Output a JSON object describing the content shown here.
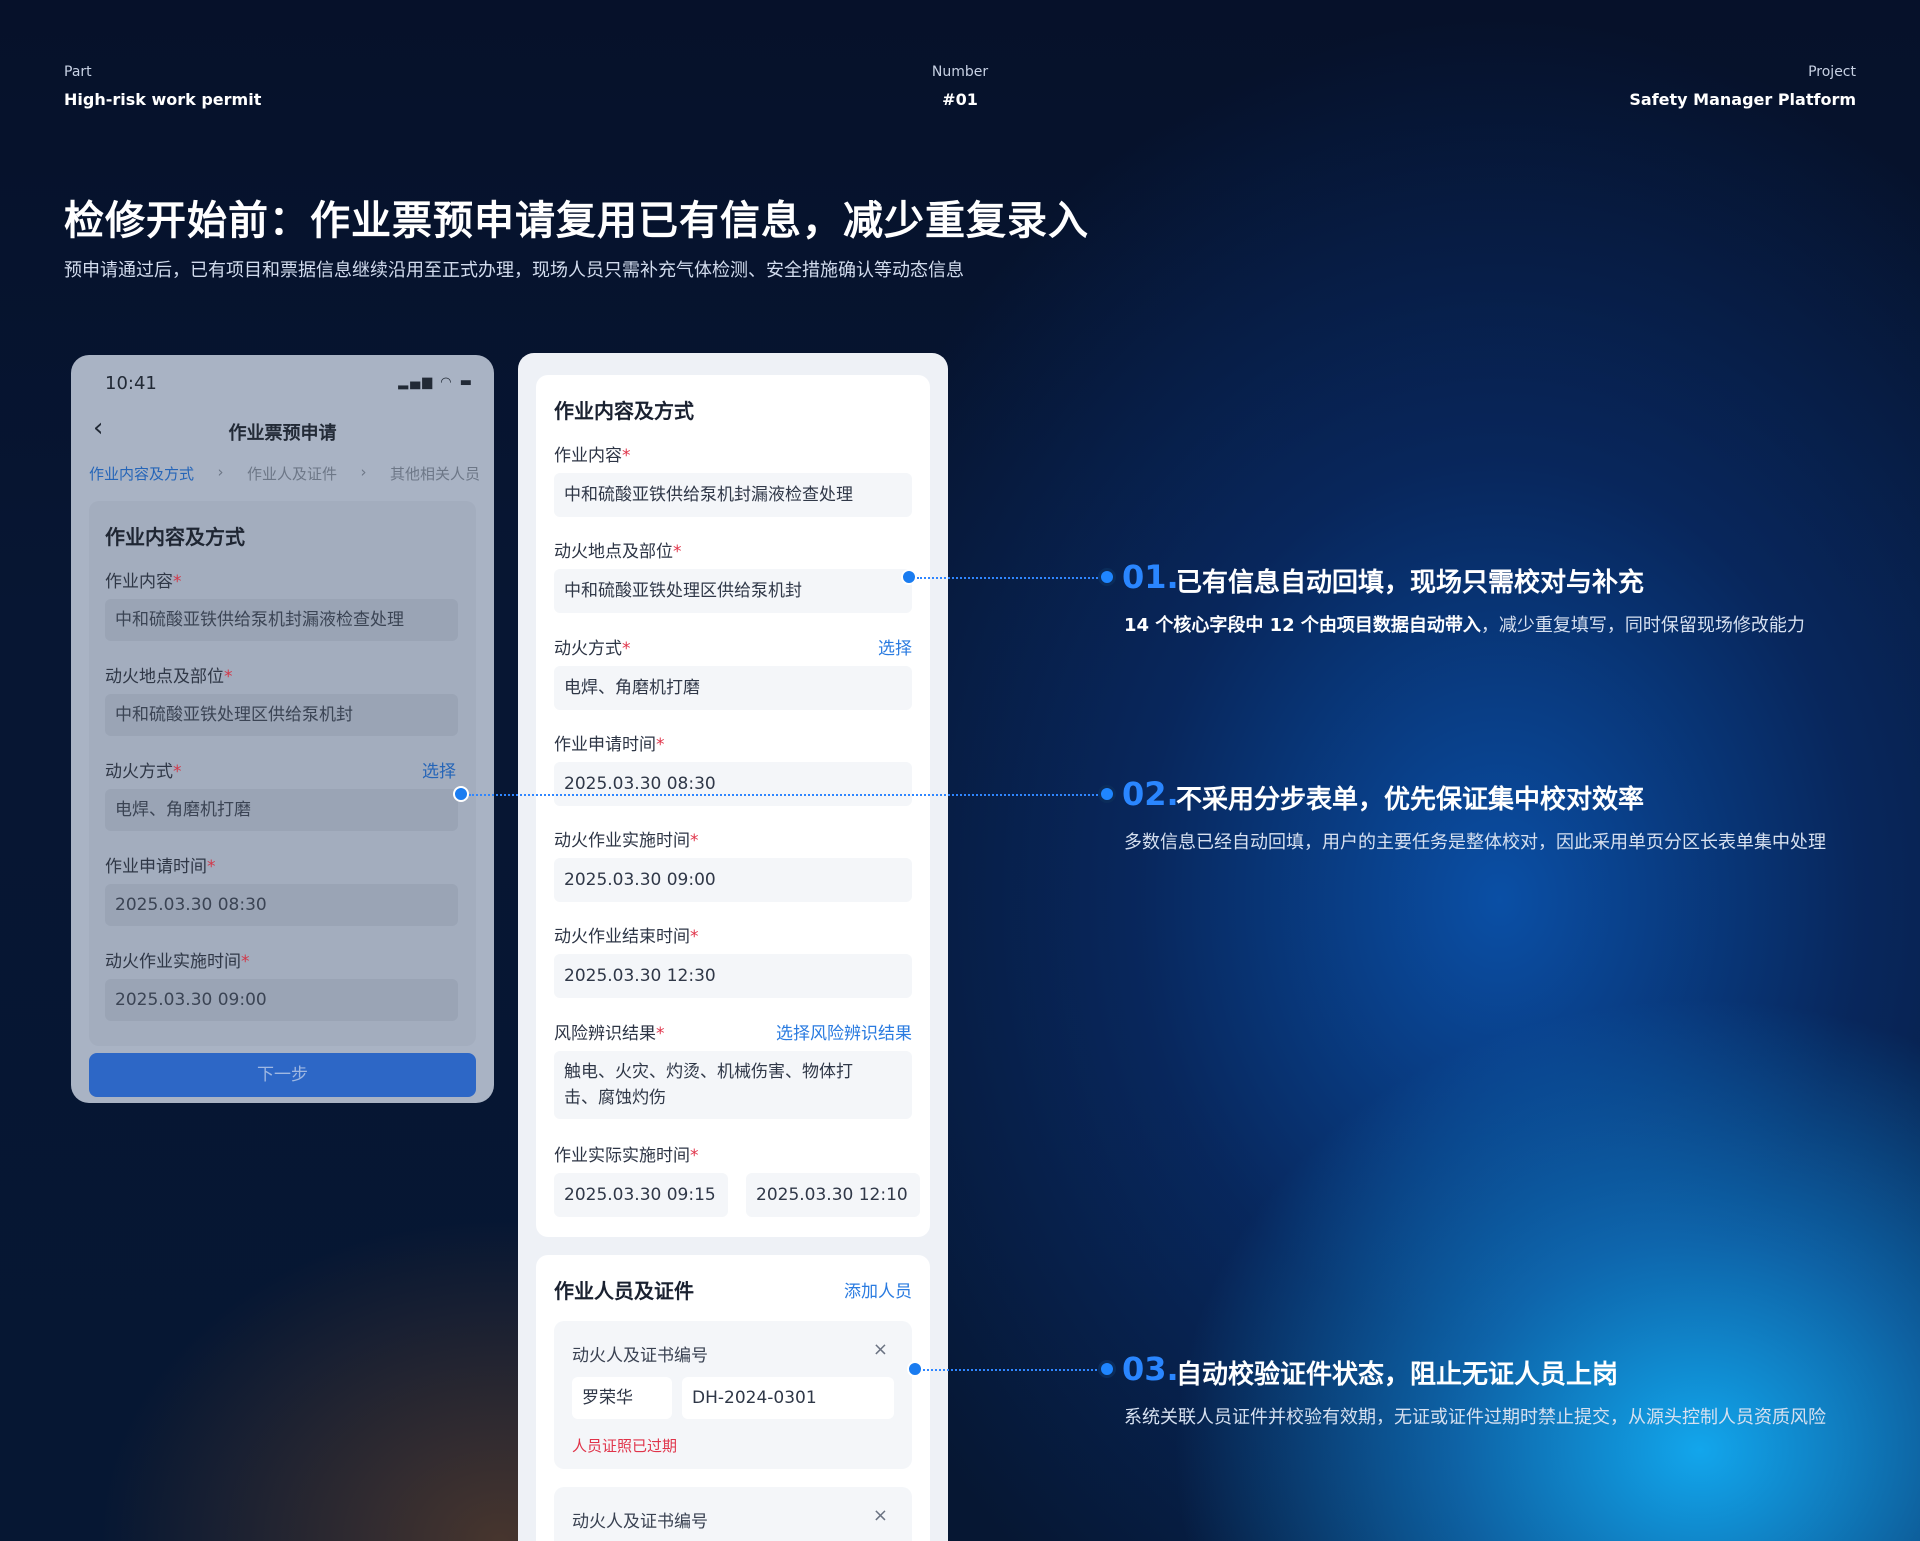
{
  "header": {
    "part_label": "Part",
    "part_value": "High-risk work permit",
    "number_label": "Number",
    "number_value": "#01",
    "project_label": "Project",
    "project_value": "Safety Manager Platform"
  },
  "hero": {
    "title": "检修开始前：作业票预申请复用已有信息，减少重复录入",
    "subtitle": "预申请通过后，已有项目和票据信息继续沿用至正式办理，现场人员只需补充气体检测、安全措施确认等动态信息"
  },
  "phone": {
    "time": "10:41",
    "status_icons": "▂▄▆ ◠ ▬",
    "back_icon": "‹",
    "title": "作业票预申请",
    "steps": [
      "作业内容及方式",
      "›",
      "作业人及证件",
      "›",
      "其他相关人员"
    ],
    "section": "作业内容及方式",
    "required_mark": "*",
    "fields": {
      "content_label": "作业内容",
      "content_value": "中和硫酸亚铁供给泵机封漏液检查处理",
      "location_label": "动火地点及部位",
      "location_value": "中和硫酸亚铁处理区供给泵机封",
      "method_label": "动火方式",
      "method_link": "选择",
      "method_value": "电焊、角磨机打磨",
      "apply_time_label": "作业申请时间",
      "apply_time_value": "2025.03.30 08:30",
      "impl_time_label": "动火作业实施时间",
      "impl_time_value": "2025.03.30 09:00"
    },
    "next_button": "下一步"
  },
  "form": {
    "section1": "作业内容及方式",
    "required_mark": "*",
    "content_label": "作业内容",
    "content_value": "中和硫酸亚铁供给泵机封漏液检查处理",
    "location_label": "动火地点及部位",
    "location_value": "中和硫酸亚铁处理区供给泵机封",
    "method_label": "动火方式",
    "method_link": "选择",
    "method_value": "电焊、角磨机打磨",
    "apply_time_label": "作业申请时间",
    "apply_time_value": "2025.03.30 08:30",
    "impl_time_label": "动火作业实施时间",
    "impl_time_value": "2025.03.30 09:00",
    "end_time_label": "动火作业结束时间",
    "end_time_value": "2025.03.30 12:30",
    "risk_label": "风险辨识结果",
    "risk_link": "选择风险辨识结果",
    "risk_value": "触电、火灾、灼烫、机械伤害、物体打击、腐蚀灼伤",
    "actual_time_label": "作业实际实施时间",
    "actual_start": "2025.03.30 09:15",
    "actual_end": "2025.03.30 12:10",
    "section2": "作业人员及证件",
    "add_person_link": "添加人员",
    "persons": [
      {
        "label": "动火人及证书编号",
        "close_icon": "×",
        "name": "罗荣华",
        "cert": "DH-2024-0301",
        "error": "人员证照已过期"
      },
      {
        "label": "动火人及证书编号",
        "close_icon": "×"
      }
    ]
  },
  "notes": [
    {
      "num": "01.",
      "title": "已有信息自动回填，现场只需校对与补充",
      "desc_bold": "14 个核心字段中 12 个由项目数据自动带入",
      "desc_rest": "，减少重复填写，同时保留现场修改能力"
    },
    {
      "num": "02.",
      "title": "不采用分步表单，优先保证集中校对效率",
      "desc": "多数信息已经自动回填，用户的主要任务是整体校对，因此采用单页分区长表单集中处理"
    },
    {
      "num": "03.",
      "title": "自动校验证件状态，阻止无证人员上岗",
      "desc": "系统关联人员证件并校验有效期，无证或证件过期时禁止提交，从源头控制人员资质风险"
    }
  ],
  "colors": {
    "accent": "#2a86ff",
    "error": "#e0344a",
    "link": "#2a7be0"
  }
}
